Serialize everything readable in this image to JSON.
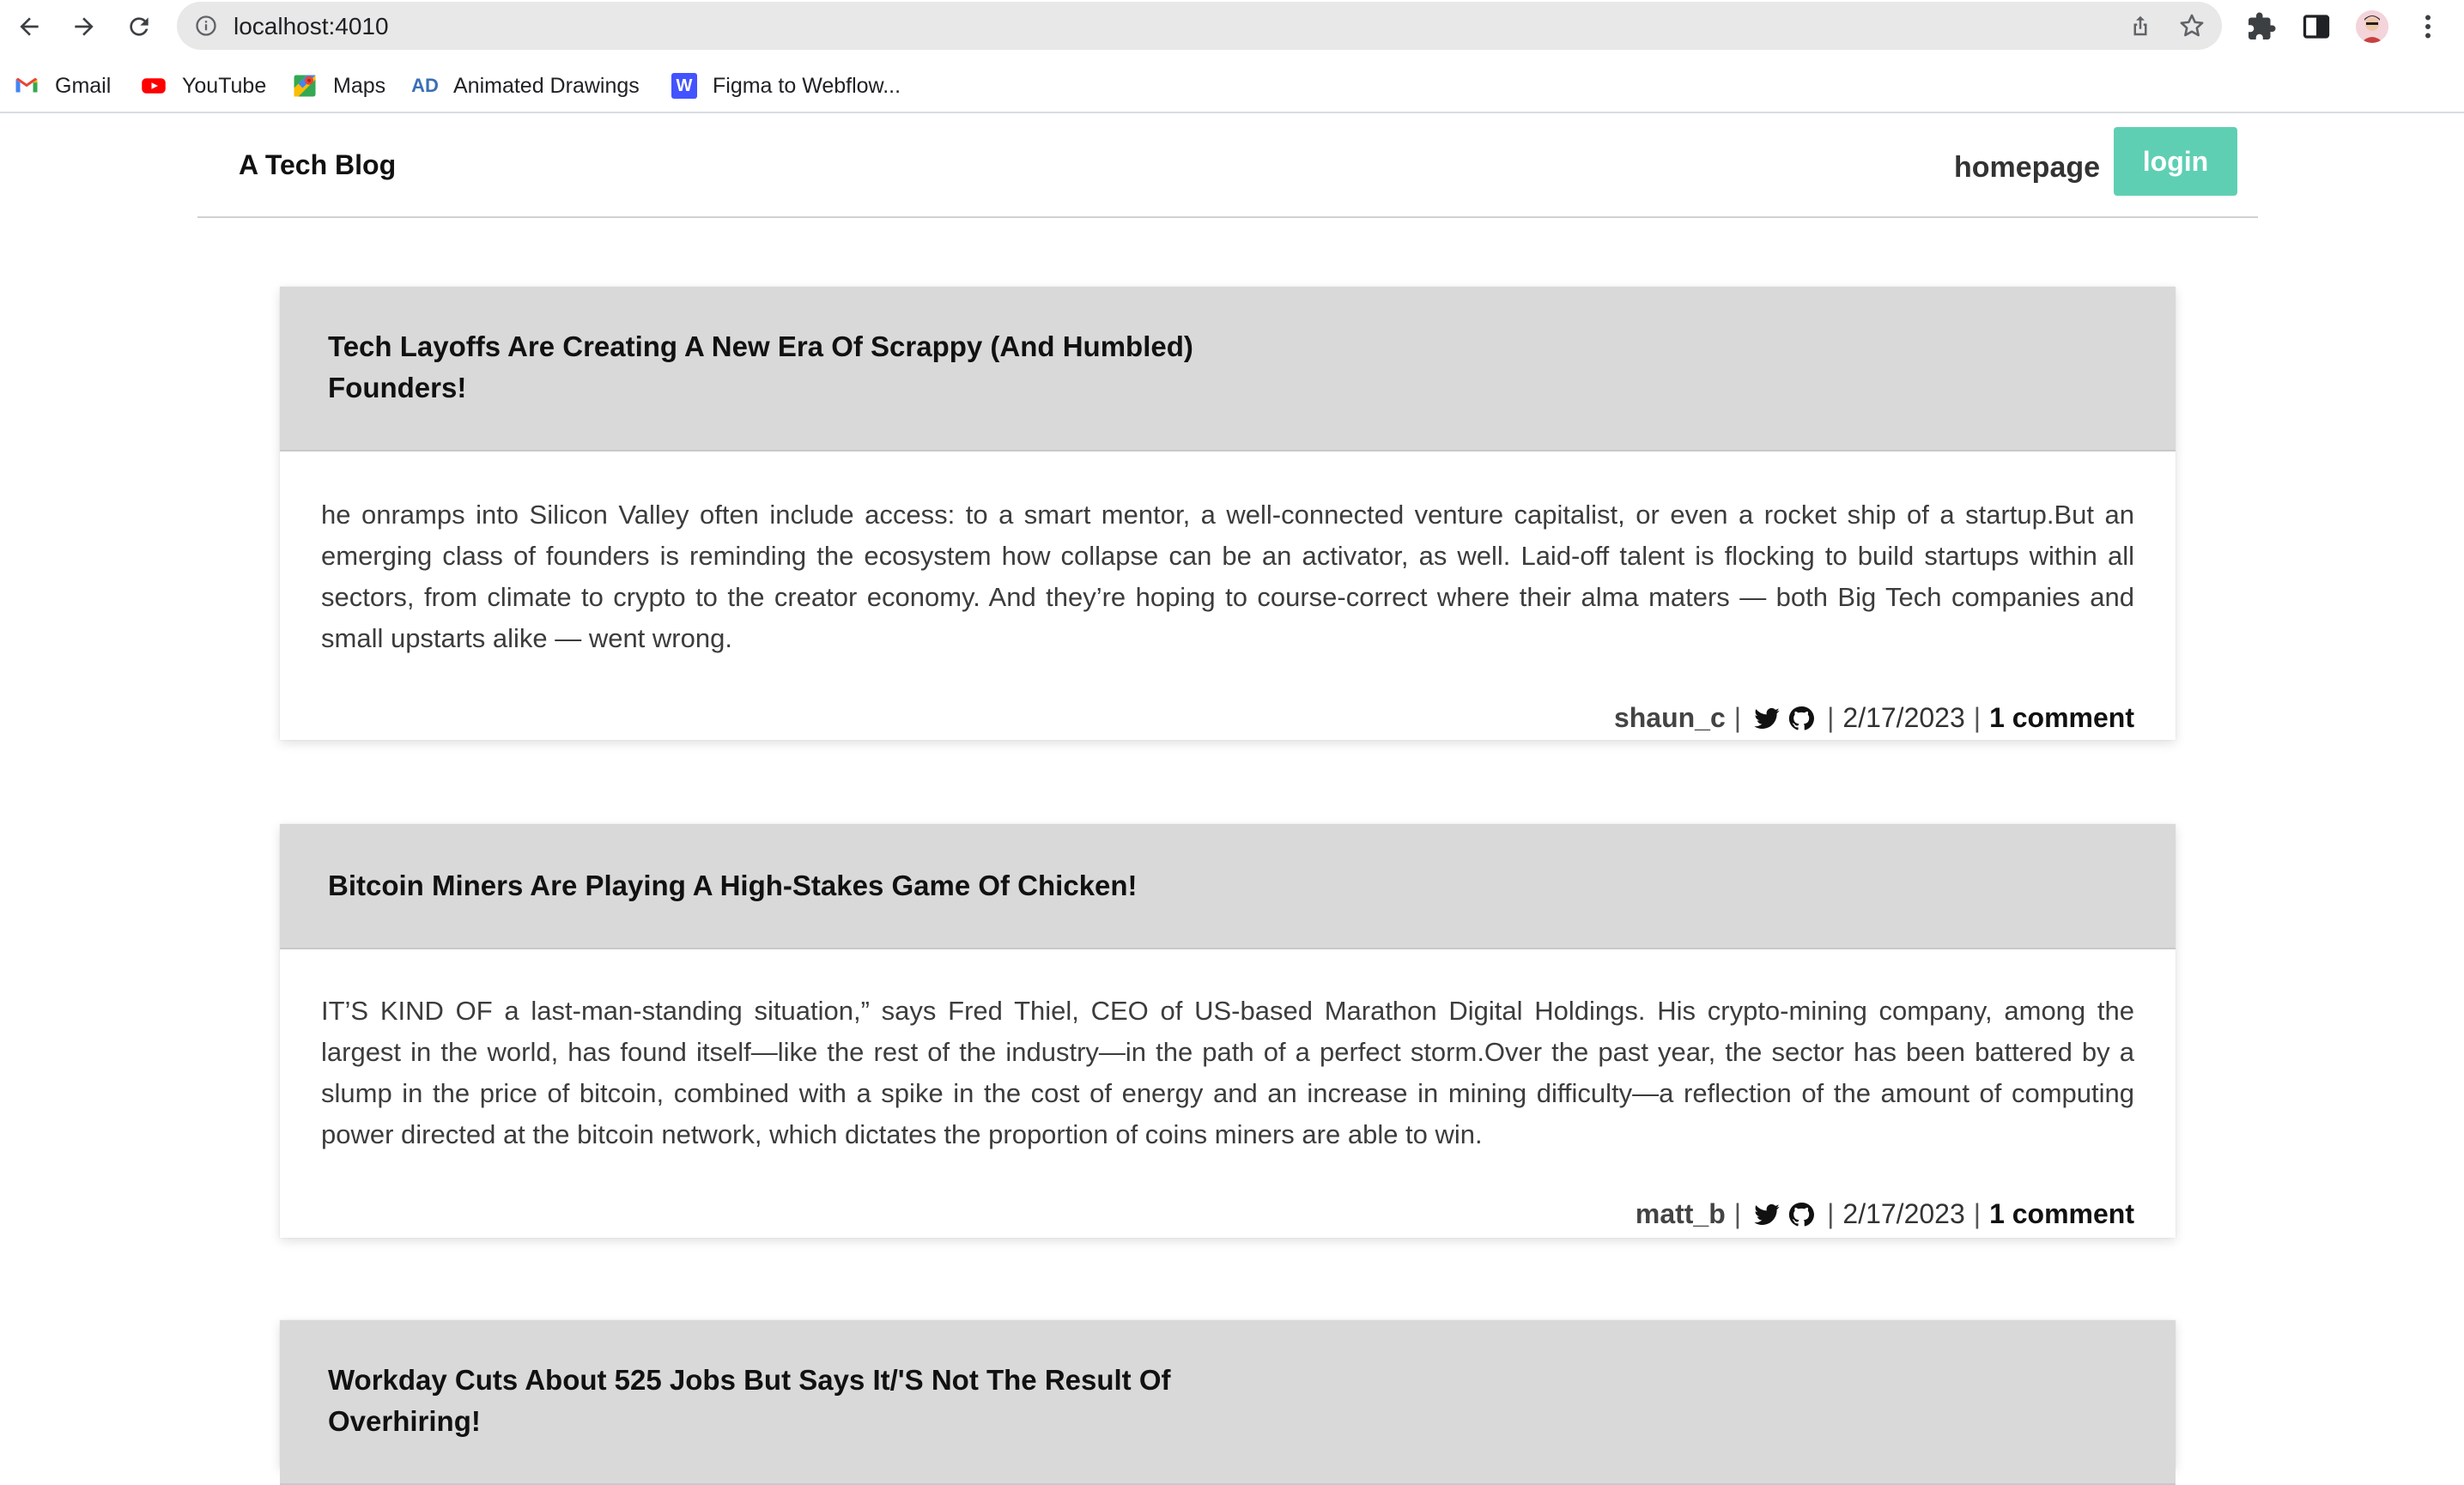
{
  "browser": {
    "url": "localhost:4010",
    "bookmarks": [
      {
        "label": "Gmail",
        "icon": "gmail-icon"
      },
      {
        "label": "YouTube",
        "icon": "youtube-icon"
      },
      {
        "label": "Maps",
        "icon": "maps-icon"
      },
      {
        "label": "Animated Drawings",
        "icon": "animated-drawings-icon",
        "icon_text": "AD"
      },
      {
        "label": "Figma to Webflow...",
        "icon": "webflow-icon",
        "icon_text": "W"
      }
    ]
  },
  "site": {
    "title": "A Tech Blog",
    "nav_home": "homepage",
    "nav_login": "login",
    "accent_color": "#5fcfb3"
  },
  "posts": [
    {
      "title": "Tech Layoffs Are Creating A New Era Of Scrappy (And Humbled) Founders!",
      "body": "he onramps into Silicon Valley often include access: to a smart mentor, a well-connected venture capitalist, or even a rocket ship of a startup.But an emerging class of founders is reminding the ecosystem how collapse can be an activator, as well. Laid-off talent is flocking to build startups within all sectors, from climate to crypto to the creator economy. And they’re hoping to course-correct where their alma maters — both Big Tech companies and small upstarts alike — went wrong.",
      "author": "shaun_c",
      "date": "2/17/2023",
      "comments": "1 comment"
    },
    {
      "title": "Bitcoin Miners Are Playing A High-Stakes Game Of Chicken!",
      "body": "IT’S KIND OF a last-man-standing situation,” says Fred Thiel, CEO of US-based Marathon Digital Holdings. His crypto-mining company, among the largest in the world, has found itself—like the rest of the industry—in the path of a perfect storm.Over the past year, the sector has been battered by a slump in the price of bitcoin, combined with a spike in the cost of energy and an increase in mining difficulty—a reflection of the amount of computing power directed at the bitcoin network, which dictates the proportion of coins miners are able to win.",
      "author": "matt_b",
      "date": "2/17/2023",
      "comments": "1 comment"
    },
    {
      "title": "Workday Cuts About 525 Jobs But Says It/'S Not The Result Of Overhiring!"
    }
  ],
  "meta_separator": "|"
}
